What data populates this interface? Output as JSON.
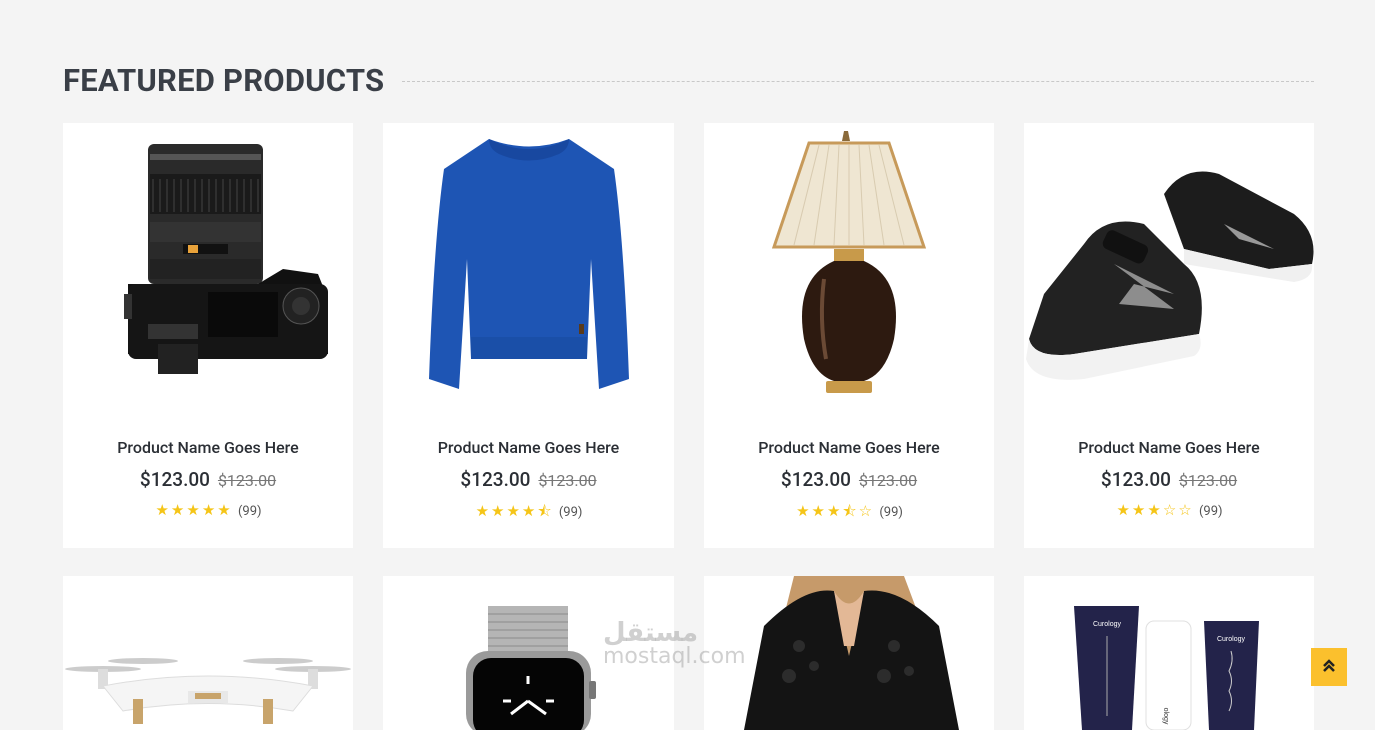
{
  "section": {
    "title": "FEATURED PRODUCTS"
  },
  "products": [
    {
      "name": "Product Name Goes Here",
      "price": "$123.00",
      "old_price": "$123.00",
      "rating": 5,
      "count": "(99)",
      "image": "camera"
    },
    {
      "name": "Product Name Goes Here",
      "price": "$123.00",
      "old_price": "$123.00",
      "rating": 4.5,
      "count": "(99)",
      "image": "sweater"
    },
    {
      "name": "Product Name Goes Here",
      "price": "$123.00",
      "old_price": "$123.00",
      "rating": 3.5,
      "count": "(99)",
      "image": "lamp"
    },
    {
      "name": "Product Name Goes Here",
      "price": "$123.00",
      "old_price": "$123.00",
      "rating": 3,
      "count": "(99)",
      "image": "sneakers"
    }
  ],
  "products_row2": [
    {
      "image": "drone"
    },
    {
      "image": "smartwatch"
    },
    {
      "image": "blouse"
    },
    {
      "image": "cosmetics",
      "labels": [
        "Curology",
        "Curology",
        "ology"
      ]
    }
  ],
  "watermark": {
    "arabic": "مستقل",
    "latin": "mostaql.com"
  },
  "colors": {
    "star": "#f5c518",
    "scroll_button": "#fbc02d",
    "title": "#3a3f47"
  },
  "scroll_top": {
    "icon": "double-chevron-up-icon"
  }
}
